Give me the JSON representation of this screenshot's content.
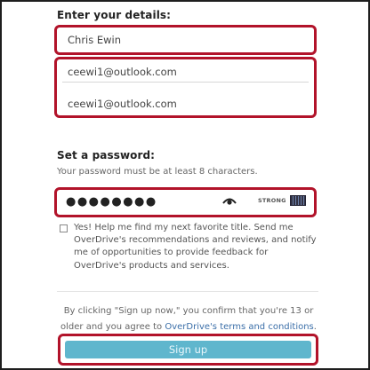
{
  "details": {
    "heading": "Enter your details:",
    "name_value": "Chris Ewin",
    "email_value": "ceewi1@outlook.com",
    "email_confirm_value": "ceewi1@outlook.com"
  },
  "password": {
    "heading": "Set a password:",
    "helper": "Your password must be at least 8 characters.",
    "masked_value": "●●●●●●●●",
    "strength_label": "STRONG",
    "toggle_icon": "eye-icon"
  },
  "consent": {
    "checked": false,
    "text": "Yes! Help me find my next favorite title. Send me OverDrive's recommendations and reviews, and notify me of opportunities to provide feedback for OverDrive's products and services."
  },
  "legal": {
    "text_before": "By clicking \"Sign up now,\" you confirm that you're 13 or older and you agree to ",
    "link_text": "OverDrive's terms and conditions",
    "text_after": "."
  },
  "signup": {
    "label": "Sign up"
  },
  "colors": {
    "highlight": "#b2132a",
    "button": "#5fb6cd",
    "link": "#3a6ea8"
  }
}
